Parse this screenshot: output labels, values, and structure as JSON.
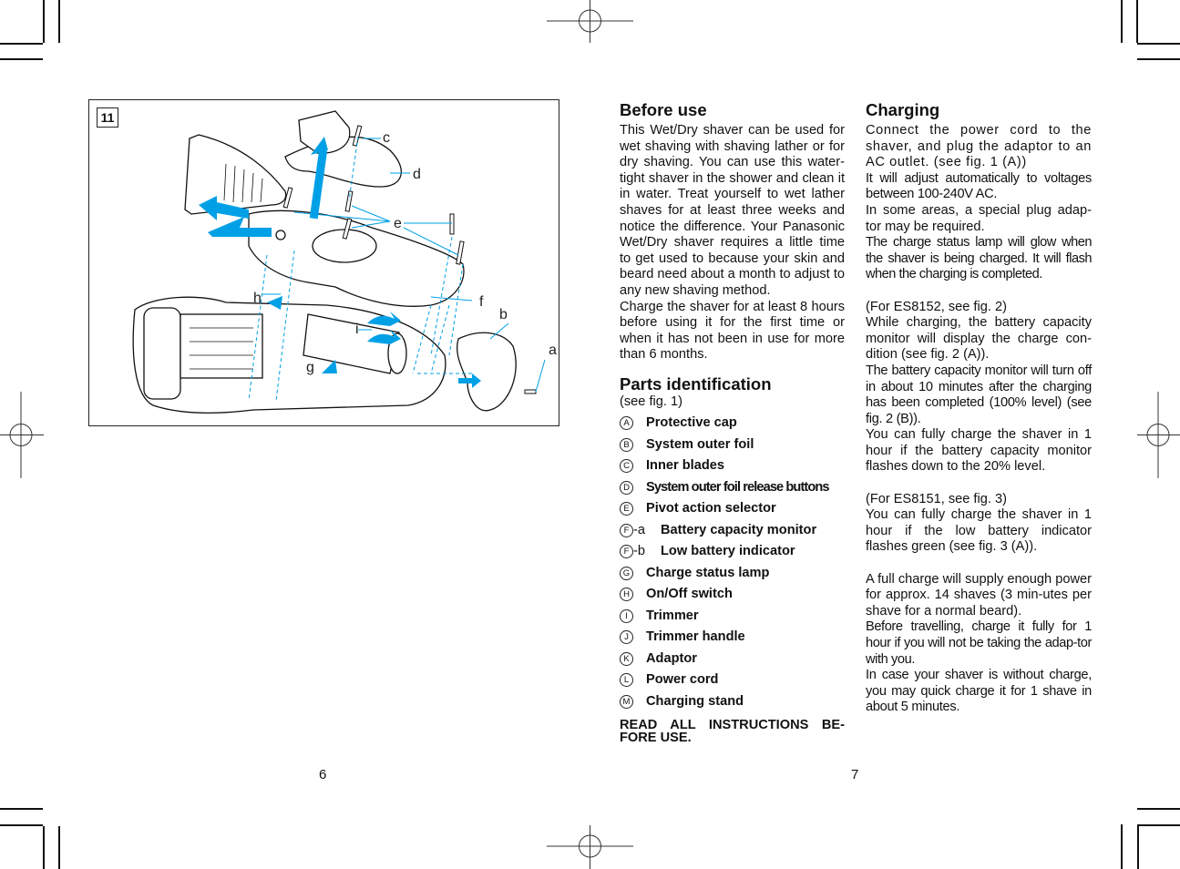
{
  "figure": {
    "number": "11",
    "callouts": [
      "a",
      "b",
      "c",
      "d",
      "e",
      "f",
      "g",
      "h",
      "i"
    ],
    "accent_color": "#00a0e6"
  },
  "before_use": {
    "heading": "Before use",
    "paragraphs": [
      "This Wet/Dry shaver can be used for wet shaving with shaving lather or for dry shaving. You can use this water-tight shaver in the shower and clean it in water. Treat yourself to wet lather shaves for at least three weeks and notice the difference. Your Panasonic Wet/Dry shaver requires a little time to get used to because your skin and beard need about a month to adjust to any new shaving method.",
      "Charge the shaver for at least 8 hours before using it for the first time or when it has not been in use for more than 6 months."
    ]
  },
  "parts_identification": {
    "heading": "Parts identification",
    "subtitle": "(see fig. 1)",
    "items": [
      {
        "key": "A",
        "suffix": "",
        "label": "Protective cap"
      },
      {
        "key": "B",
        "suffix": "",
        "label": "System outer foil"
      },
      {
        "key": "C",
        "suffix": "",
        "label": "Inner blades"
      },
      {
        "key": "D",
        "suffix": "",
        "label": "System outer foil release buttons"
      },
      {
        "key": "E",
        "suffix": "",
        "label": "Pivot action selector"
      },
      {
        "key": "F",
        "suffix": "-a",
        "label": "Battery capacity monitor"
      },
      {
        "key": "F",
        "suffix": "-b",
        "label": "Low battery indicator"
      },
      {
        "key": "G",
        "suffix": "",
        "label": "Charge status lamp"
      },
      {
        "key": "H",
        "suffix": "",
        "label": "On/Off switch"
      },
      {
        "key": "I",
        "suffix": "",
        "label": "Trimmer"
      },
      {
        "key": "J",
        "suffix": "",
        "label": "Trimmer handle"
      },
      {
        "key": "K",
        "suffix": "",
        "label": "Adaptor"
      },
      {
        "key": "L",
        "suffix": "",
        "label": "Power cord"
      },
      {
        "key": "M",
        "suffix": "",
        "label": "Charging stand"
      }
    ],
    "warning": "READ ALL INSTRUCTIONS BE-FORE USE."
  },
  "charging": {
    "heading": "Charging",
    "p1": "Connect the power cord to the shaver, and plug the adaptor to an AC outlet. (see fig. 1 (A))",
    "p2": "It will adjust automatically to voltages between 100-240V AC.",
    "p3": "In some areas, a special plug adap-tor may be required.",
    "p4": "The charge status lamp will glow when the shaver is being charged. It will flash when the charging is completed.",
    "es8152_title": "(For ES8152, see fig. 2)",
    "es8152_p1": "While charging, the battery capacity monitor will display the charge con-dition (see fig. 2 (A)).",
    "es8152_p2": "The battery capacity monitor will turn off in about 10 minutes after the charging has been completed (100% level) (see fig. 2 (B)).",
    "es8152_p3": "You can fully charge the shaver in 1 hour if the battery capacity monitor flashes down to the 20% level.",
    "es8151_title": "(For ES8151, see fig. 3)",
    "es8151_p1": "You can fully charge the shaver in 1 hour if the low battery indicator flashes green (see fig. 3 (A)).",
    "full_p1": "A full charge will supply enough power for approx. 14 shaves (3 min-utes per shave for a normal beard).",
    "full_p2": "Before travelling, charge it fully for 1 hour if you will not be taking the adap-tor with you.",
    "full_p3": "In case your shaver is without charge, you may quick charge it for 1 shave in about 5 minutes."
  },
  "page_numbers": {
    "left": "6",
    "right": "7"
  }
}
